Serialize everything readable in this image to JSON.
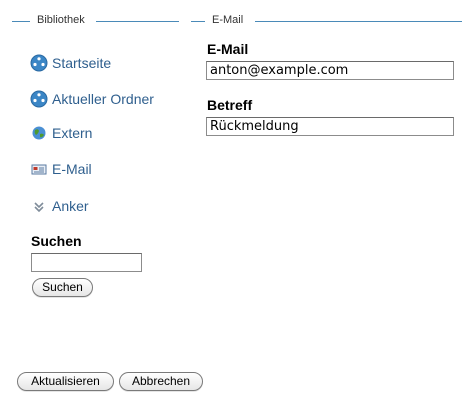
{
  "left_panel": {
    "legend": "Bibliothek",
    "nav": [
      {
        "label": "Startseite",
        "icon": "home-icon"
      },
      {
        "label": "Aktueller Ordner",
        "icon": "folder-icon"
      },
      {
        "label": "Extern",
        "icon": "globe-icon"
      },
      {
        "label": "E-Mail",
        "icon": "email-icon"
      },
      {
        "label": "Anker",
        "icon": "anchor-icon"
      }
    ],
    "search": {
      "label": "Suchen",
      "value": "",
      "button_label": "Suchen"
    }
  },
  "right_panel": {
    "legend": "E-Mail",
    "email_label": "E-Mail",
    "email_value": "anton@example.com",
    "subject_label": "Betreff",
    "subject_value": "Rückmeldung"
  },
  "footer": {
    "update_button": "Aktualisieren",
    "cancel_button": "Abbrechen"
  },
  "colors": {
    "legend_line": "#4a8ab8",
    "link_text": "#2f5f8e"
  }
}
